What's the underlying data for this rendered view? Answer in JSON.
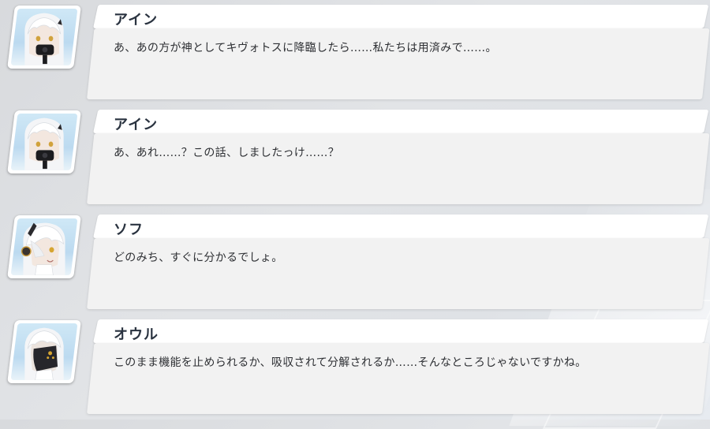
{
  "dialogue_log": [
    {
      "speaker": "アイン",
      "portrait": "ain-portrait",
      "text": "あ、あの方が神としてキヴォトスに降臨したら……私たちは用済みで……。"
    },
    {
      "speaker": "アイン",
      "portrait": "ain-portrait",
      "text": "あ、あれ……？この話、しましたっけ……？"
    },
    {
      "speaker": "ソフ",
      "portrait": "sof-portrait",
      "text": "どのみち、すぐに分かるでしょ。"
    },
    {
      "speaker": "オウル",
      "portrait": "owl-portrait",
      "text": "このまま機能を止められるか、吸収されて分解されるか……そんなところじゃないですかね。"
    }
  ]
}
